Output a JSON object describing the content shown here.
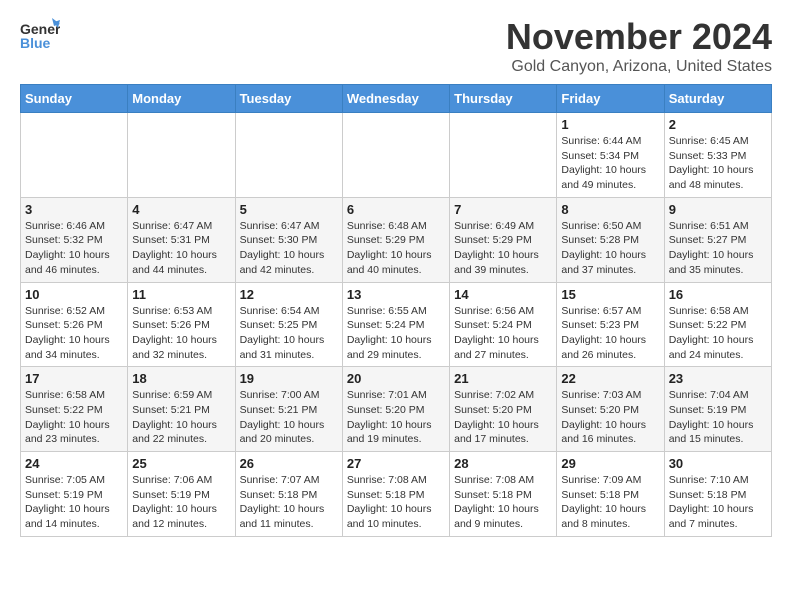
{
  "header": {
    "logo_general": "General",
    "logo_blue": "Blue",
    "title": "November 2024",
    "location": "Gold Canyon, Arizona, United States"
  },
  "weekdays": [
    "Sunday",
    "Monday",
    "Tuesday",
    "Wednesday",
    "Thursday",
    "Friday",
    "Saturday"
  ],
  "weeks": [
    [
      {
        "day": "",
        "info": ""
      },
      {
        "day": "",
        "info": ""
      },
      {
        "day": "",
        "info": ""
      },
      {
        "day": "",
        "info": ""
      },
      {
        "day": "",
        "info": ""
      },
      {
        "day": "1",
        "info": "Sunrise: 6:44 AM\nSunset: 5:34 PM\nDaylight: 10 hours and 49 minutes."
      },
      {
        "day": "2",
        "info": "Sunrise: 6:45 AM\nSunset: 5:33 PM\nDaylight: 10 hours and 48 minutes."
      }
    ],
    [
      {
        "day": "3",
        "info": "Sunrise: 6:46 AM\nSunset: 5:32 PM\nDaylight: 10 hours and 46 minutes."
      },
      {
        "day": "4",
        "info": "Sunrise: 6:47 AM\nSunset: 5:31 PM\nDaylight: 10 hours and 44 minutes."
      },
      {
        "day": "5",
        "info": "Sunrise: 6:47 AM\nSunset: 5:30 PM\nDaylight: 10 hours and 42 minutes."
      },
      {
        "day": "6",
        "info": "Sunrise: 6:48 AM\nSunset: 5:29 PM\nDaylight: 10 hours and 40 minutes."
      },
      {
        "day": "7",
        "info": "Sunrise: 6:49 AM\nSunset: 5:29 PM\nDaylight: 10 hours and 39 minutes."
      },
      {
        "day": "8",
        "info": "Sunrise: 6:50 AM\nSunset: 5:28 PM\nDaylight: 10 hours and 37 minutes."
      },
      {
        "day": "9",
        "info": "Sunrise: 6:51 AM\nSunset: 5:27 PM\nDaylight: 10 hours and 35 minutes."
      }
    ],
    [
      {
        "day": "10",
        "info": "Sunrise: 6:52 AM\nSunset: 5:26 PM\nDaylight: 10 hours and 34 minutes."
      },
      {
        "day": "11",
        "info": "Sunrise: 6:53 AM\nSunset: 5:26 PM\nDaylight: 10 hours and 32 minutes."
      },
      {
        "day": "12",
        "info": "Sunrise: 6:54 AM\nSunset: 5:25 PM\nDaylight: 10 hours and 31 minutes."
      },
      {
        "day": "13",
        "info": "Sunrise: 6:55 AM\nSunset: 5:24 PM\nDaylight: 10 hours and 29 minutes."
      },
      {
        "day": "14",
        "info": "Sunrise: 6:56 AM\nSunset: 5:24 PM\nDaylight: 10 hours and 27 minutes."
      },
      {
        "day": "15",
        "info": "Sunrise: 6:57 AM\nSunset: 5:23 PM\nDaylight: 10 hours and 26 minutes."
      },
      {
        "day": "16",
        "info": "Sunrise: 6:58 AM\nSunset: 5:22 PM\nDaylight: 10 hours and 24 minutes."
      }
    ],
    [
      {
        "day": "17",
        "info": "Sunrise: 6:58 AM\nSunset: 5:22 PM\nDaylight: 10 hours and 23 minutes."
      },
      {
        "day": "18",
        "info": "Sunrise: 6:59 AM\nSunset: 5:21 PM\nDaylight: 10 hours and 22 minutes."
      },
      {
        "day": "19",
        "info": "Sunrise: 7:00 AM\nSunset: 5:21 PM\nDaylight: 10 hours and 20 minutes."
      },
      {
        "day": "20",
        "info": "Sunrise: 7:01 AM\nSunset: 5:20 PM\nDaylight: 10 hours and 19 minutes."
      },
      {
        "day": "21",
        "info": "Sunrise: 7:02 AM\nSunset: 5:20 PM\nDaylight: 10 hours and 17 minutes."
      },
      {
        "day": "22",
        "info": "Sunrise: 7:03 AM\nSunset: 5:20 PM\nDaylight: 10 hours and 16 minutes."
      },
      {
        "day": "23",
        "info": "Sunrise: 7:04 AM\nSunset: 5:19 PM\nDaylight: 10 hours and 15 minutes."
      }
    ],
    [
      {
        "day": "24",
        "info": "Sunrise: 7:05 AM\nSunset: 5:19 PM\nDaylight: 10 hours and 14 minutes."
      },
      {
        "day": "25",
        "info": "Sunrise: 7:06 AM\nSunset: 5:19 PM\nDaylight: 10 hours and 12 minutes."
      },
      {
        "day": "26",
        "info": "Sunrise: 7:07 AM\nSunset: 5:18 PM\nDaylight: 10 hours and 11 minutes."
      },
      {
        "day": "27",
        "info": "Sunrise: 7:08 AM\nSunset: 5:18 PM\nDaylight: 10 hours and 10 minutes."
      },
      {
        "day": "28",
        "info": "Sunrise: 7:08 AM\nSunset: 5:18 PM\nDaylight: 10 hours and 9 minutes."
      },
      {
        "day": "29",
        "info": "Sunrise: 7:09 AM\nSunset: 5:18 PM\nDaylight: 10 hours and 8 minutes."
      },
      {
        "day": "30",
        "info": "Sunrise: 7:10 AM\nSunset: 5:18 PM\nDaylight: 10 hours and 7 minutes."
      }
    ]
  ]
}
